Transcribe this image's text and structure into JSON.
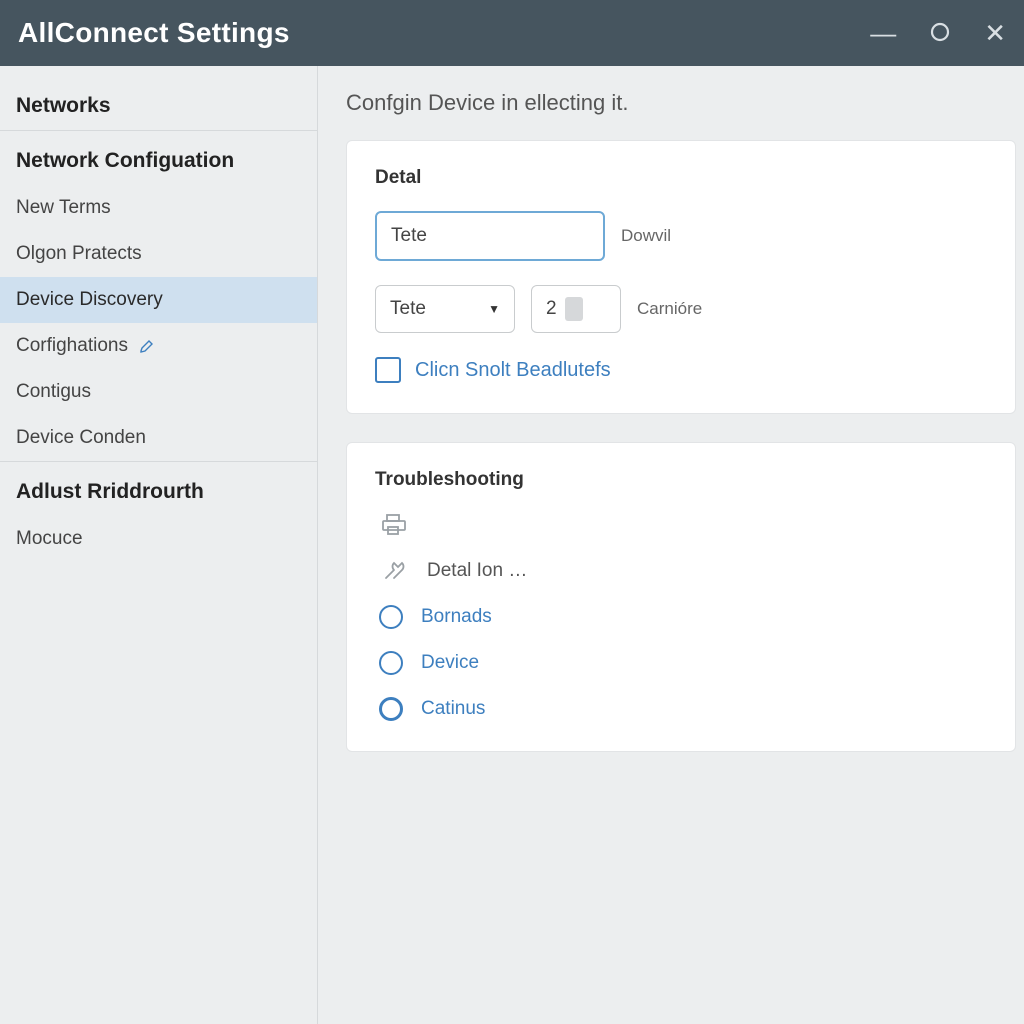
{
  "titlebar": {
    "title": "AllConnect Settings"
  },
  "sidebar": {
    "sections": [
      {
        "title": "Networks",
        "items": []
      },
      {
        "title": "Network Configuation",
        "items": [
          {
            "label": "New Terms",
            "active": false
          },
          {
            "label": "Olgon Pratects",
            "active": false
          },
          {
            "label": "Device Discovery",
            "active": true
          },
          {
            "label": "Corfighations",
            "active": false,
            "edit": true
          },
          {
            "label": "Contigus",
            "active": false
          },
          {
            "label": "Device Conden",
            "active": false
          }
        ]
      },
      {
        "title": "Adlust Rriddrourth",
        "items": [
          {
            "label": "Mocuce",
            "active": false
          }
        ]
      }
    ]
  },
  "main": {
    "title": "Confgin Device in ellecting it.",
    "detal": {
      "heading": "Detal",
      "field1": {
        "value": "Tete",
        "label": "Dowvil"
      },
      "select": {
        "value": "Tete"
      },
      "numeric": {
        "value": "2",
        "label": "Carnióre"
      },
      "checkbox": {
        "checked": false,
        "label": "Clicn Snolt Beadlutefs"
      }
    },
    "troubleshooting": {
      "heading": "Troubleshooting",
      "items": [
        {
          "type": "icon-only"
        },
        {
          "type": "label",
          "label": "Detal Ion …"
        },
        {
          "type": "radio",
          "label": "Bornads"
        },
        {
          "type": "radio",
          "label": "Device"
        },
        {
          "type": "radio",
          "label": "Catinus",
          "strong": true
        }
      ]
    }
  }
}
